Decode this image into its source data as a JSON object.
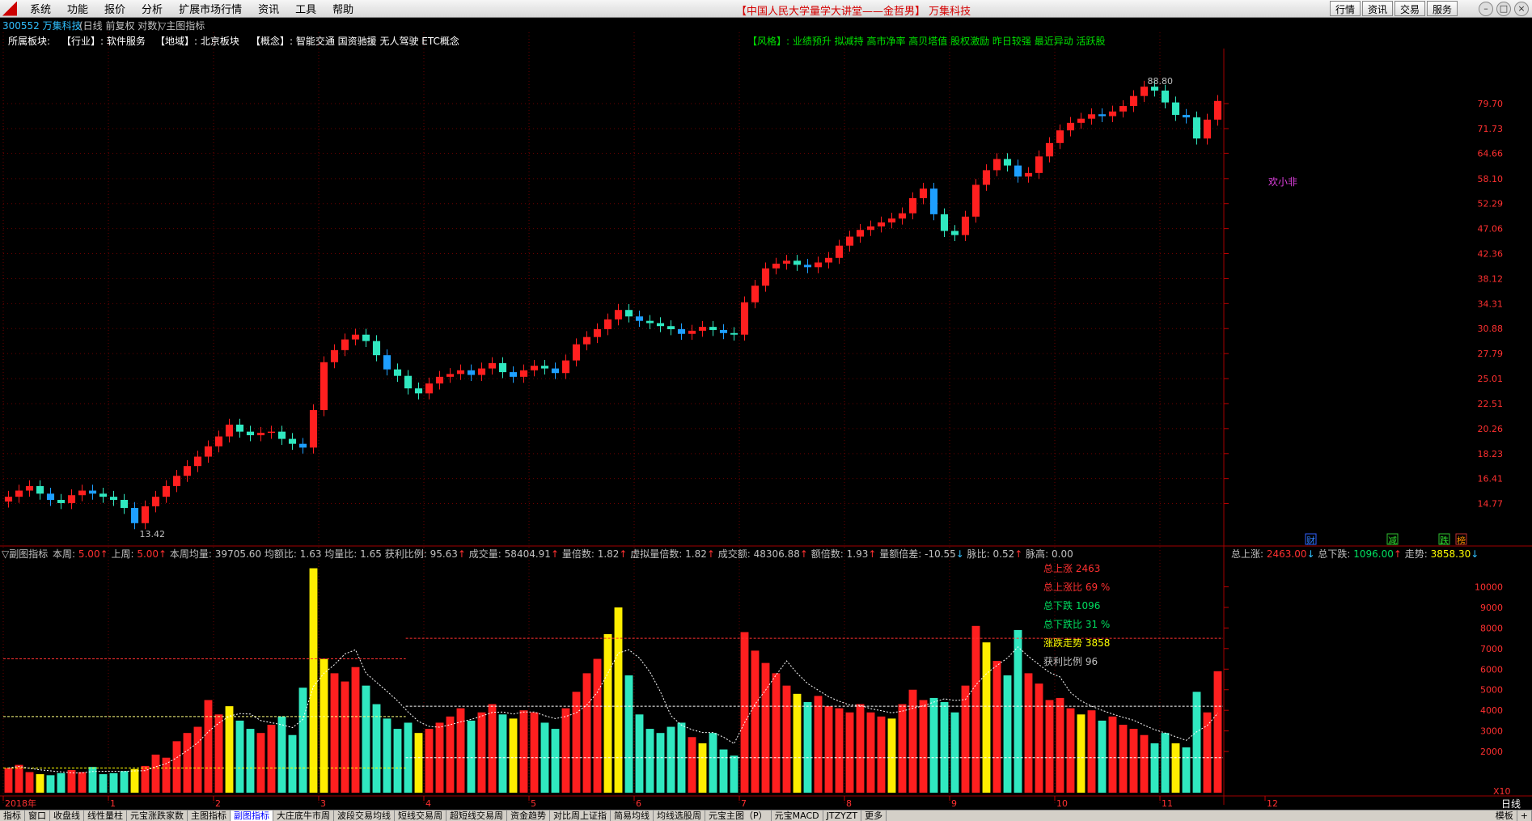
{
  "menubar": {
    "items": [
      "系统",
      "功能",
      "报价",
      "分析",
      "扩展市场行情",
      "资讯",
      "工具",
      "帮助"
    ],
    "center_title": "【中国人民大学量学大讲堂——金哲男】 万集科技",
    "right_buttons": [
      "行情",
      "资讯",
      "交易",
      "服务"
    ]
  },
  "header": {
    "stock_code": "300552 万集科技",
    "mode": "(日线 前复权 对数)",
    "indicator": "▽主图指标"
  },
  "info_line": {
    "label": "所属板块:",
    "industry": "【行业】: 软件服务",
    "region": "【地域】: 北京板块",
    "concept": "【概念】: 智能交通 国资驰援 无人驾驶 ETC概念",
    "style": "【风格】: 业绩预升 拟减持 高市净率 高贝塔值 股权激励 昨日较强 最近异动 活跃股"
  },
  "price_axis": {
    "ticks": [
      "79.70",
      "71.73",
      "64.66",
      "58.10",
      "52.29",
      "47.06",
      "42.36",
      "38.12",
      "34.31",
      "30.88",
      "27.79",
      "25.01",
      "22.51",
      "20.26",
      "18.23",
      "16.41",
      "14.77"
    ],
    "high_label": "88.80",
    "low_label": "13.42",
    "annotation": "欢小非"
  },
  "event_marks": [
    "财",
    "减",
    "跌",
    "榜"
  ],
  "sub_header": {
    "title": "▽副图指标",
    "fields": [
      {
        "label": "本周:",
        "value": "5.00",
        "color": "#ff3030",
        "arrow": "↑",
        "arrow_color": "#ff3030"
      },
      {
        "label": "上周:",
        "value": "5.00",
        "color": "#ff3030",
        "arrow": "↑",
        "arrow_color": "#ff3030"
      },
      {
        "label": "本周均量:",
        "value": "39705.60",
        "color": "#c0c0c0",
        "arrow": "",
        "arrow_color": "#c0c0c0"
      },
      {
        "label": "均额比:",
        "value": "1.63",
        "color": "#c0c0c0",
        "arrow": "",
        "arrow_color": "#c0c0c0"
      },
      {
        "label": "均量比:",
        "value": "1.65",
        "color": "#c0c0c0",
        "arrow": "",
        "arrow_color": "#c0c0c0"
      },
      {
        "label": "获利比例:",
        "value": "95.63",
        "color": "#c0c0c0",
        "arrow": "↑",
        "arrow_color": "#ff3030"
      },
      {
        "label": "成交量:",
        "value": "58404.91",
        "color": "#c0c0c0",
        "arrow": "↑",
        "arrow_color": "#ff3030"
      },
      {
        "label": "量倍数:",
        "value": "1.82",
        "color": "#c0c0c0",
        "arrow": "↑",
        "arrow_color": "#ff3030"
      },
      {
        "label": "虚拟量倍数:",
        "value": "1.82",
        "color": "#c0c0c0",
        "arrow": "↑",
        "arrow_color": "#ff3030"
      },
      {
        "label": "成交额:",
        "value": "48306.88",
        "color": "#c0c0c0",
        "arrow": "↑",
        "arrow_color": "#ff3030"
      },
      {
        "label": "额倍数:",
        "value": "1.93",
        "color": "#c0c0c0",
        "arrow": "↑",
        "arrow_color": "#ff3030"
      },
      {
        "label": "量额倍差:",
        "value": "-10.55",
        "color": "#c0c0c0",
        "arrow": "↓",
        "arrow_color": "#30c0ff"
      },
      {
        "label": "脉比:",
        "value": "0.52",
        "color": "#c0c0c0",
        "arrow": "↑",
        "arrow_color": "#ff3030"
      },
      {
        "label": "脉高:",
        "value": "0.00",
        "color": "#c0c0c0",
        "arrow": "",
        "arrow_color": "#c0c0c0"
      }
    ],
    "right": [
      {
        "label": "总上涨:",
        "value": "2463.00",
        "color": "#ff3030",
        "arrow": "↓",
        "arrow_color": "#30c0ff"
      },
      {
        "label": "总下跌:",
        "value": "1096.00",
        "color": "#00e060",
        "arrow": "↑",
        "arrow_color": "#ff3030"
      },
      {
        "label": "走势:",
        "value": "3858.30",
        "color": "#ffff00",
        "arrow": "↓",
        "arrow_color": "#30c0ff"
      }
    ]
  },
  "stats_box": [
    {
      "text": "总上涨 2463",
      "color": "#ff3030"
    },
    {
      "text": "总上涨比 69 %",
      "color": "#ff3030"
    },
    {
      "text": "总下跌 1096",
      "color": "#00e060"
    },
    {
      "text": "总下跌比 31 %",
      "color": "#00e060"
    },
    {
      "text": "涨跌走势 3858",
      "color": "#ffff00"
    },
    {
      "text": "获利比例 96",
      "color": "#c0c0c0"
    }
  ],
  "volume_axis": {
    "ticks": [
      "10000",
      "9000",
      "8000",
      "7000",
      "6000",
      "5000",
      "4000",
      "3000",
      "2000"
    ],
    "unit": "X10"
  },
  "month_axis": [
    "2018年",
    "1",
    "2",
    "3",
    "4",
    "5",
    "6",
    "7",
    "8",
    "9",
    "10",
    "11",
    "12"
  ],
  "period_label": "日线",
  "tabs": [
    "指标",
    "窗口",
    "收盘线",
    "线性量柱",
    "元宝涨跌家数",
    "主图指标",
    "副图指标",
    "大庄底牛市周",
    "波段交易均线",
    "短线交易周",
    "超短线交易周",
    "资金趋势",
    "对比周上证指",
    "简易均线",
    "均线选股周",
    "元宝主图（P）",
    "元宝MACD",
    "JTZYZT",
    "更多"
  ],
  "active_tab": "副图指标",
  "tab_right": [
    "模板",
    "+"
  ],
  "colors": {
    "up": "#ff1f1f",
    "down": "#30e8c0",
    "down_blue": "#1e9fff",
    "special": "#ffee00",
    "grid": "#6a0000",
    "axis_text": "#ff3030"
  },
  "chart_data": [
    {
      "type": "candlestick",
      "title": "",
      "xlabel": "",
      "ylabel": "",
      "scale": "log",
      "ylim": [
        13.0,
        92.0
      ],
      "x": [
        "2018-01",
        "2018-01",
        "2018-01",
        "2018-01",
        "2018-01",
        "2018-01",
        "2018-01",
        "2018-01",
        "2018-01",
        "2018-01",
        "2018-02",
        "2018-02",
        "2018-02",
        "2018-02",
        "2018-02",
        "2018-02",
        "2018-02",
        "2018-02",
        "2018-02",
        "2018-02",
        "2018-03",
        "2018-03",
        "2018-03",
        "2018-03",
        "2018-03",
        "2018-03",
        "2018-03",
        "2018-03",
        "2018-03",
        "2018-03",
        "2018-04",
        "2018-04",
        "2018-04",
        "2018-04",
        "2018-04",
        "2018-04",
        "2018-04",
        "2018-04",
        "2018-04",
        "2018-04",
        "2018-05",
        "2018-05",
        "2018-05",
        "2018-05",
        "2018-05",
        "2018-05",
        "2018-05",
        "2018-05",
        "2018-05",
        "2018-05",
        "2018-06",
        "2018-06",
        "2018-06",
        "2018-06",
        "2018-06",
        "2018-06",
        "2018-06",
        "2018-06",
        "2018-06",
        "2018-06",
        "2018-07",
        "2018-07",
        "2018-07",
        "2018-07",
        "2018-07",
        "2018-07",
        "2018-07",
        "2018-07",
        "2018-07",
        "2018-07",
        "2018-08",
        "2018-08",
        "2018-08",
        "2018-08",
        "2018-08",
        "2018-08",
        "2018-08",
        "2018-08",
        "2018-08",
        "2018-08",
        "2018-09",
        "2018-09",
        "2018-09",
        "2018-09",
        "2018-09",
        "2018-09",
        "2018-09",
        "2018-09",
        "2018-09",
        "2018-09",
        "2018-10",
        "2018-10",
        "2018-10",
        "2018-10",
        "2018-10",
        "2018-10",
        "2018-10",
        "2018-10",
        "2018-10",
        "2018-10",
        "2018-11",
        "2018-11",
        "2018-11",
        "2018-11",
        "2018-11",
        "2018-11",
        "2018-11",
        "2018-11",
        "2018-11",
        "2018-11",
        "2018-12",
        "2018-12",
        "2018-12",
        "2018-12",
        "2018-12",
        "2018-12"
      ],
      "close": [
        15.2,
        15.6,
        15.9,
        15.4,
        15.0,
        14.8,
        15.3,
        15.6,
        15.4,
        15.2,
        15.0,
        14.5,
        13.6,
        14.6,
        15.2,
        15.9,
        16.6,
        17.3,
        18.0,
        18.8,
        19.6,
        20.6,
        20.0,
        19.7,
        19.9,
        20.0,
        19.4,
        19.0,
        18.7,
        21.9,
        26.8,
        28.2,
        29.5,
        30.1,
        29.3,
        27.6,
        26.0,
        25.3,
        24.0,
        23.5,
        24.5,
        25.2,
        25.5,
        25.9,
        25.4,
        26.1,
        26.7,
        25.7,
        25.2,
        25.9,
        26.4,
        26.1,
        25.6,
        27.0,
        28.9,
        29.8,
        30.8,
        32.1,
        33.4,
        32.5,
        31.9,
        31.6,
        31.2,
        30.8,
        30.2,
        30.6,
        31.1,
        30.7,
        30.3,
        30.1,
        34.5,
        37.0,
        39.8,
        40.6,
        41.1,
        40.4,
        40.0,
        40.8,
        41.6,
        43.8,
        45.5,
        46.8,
        47.5,
        48.3,
        49.1,
        50.2,
        53.5,
        55.7,
        50.0,
        46.6,
        45.8,
        49.5,
        56.6,
        60.2,
        63.1,
        61.4,
        58.6,
        59.5,
        63.8,
        67.5,
        71.2,
        73.5,
        74.8,
        76.2,
        75.6,
        77.1,
        78.9,
        82.3,
        85.6,
        84.2,
        80.1,
        76.0,
        75.2,
        68.8,
        74.5,
        80.6
      ],
      "volume": [
        1200,
        1350,
        1000,
        900,
        850,
        950,
        1100,
        1000,
        1250,
        900,
        950,
        1050,
        1150,
        1300,
        1850,
        1700,
        2500,
        2900,
        3200,
        4500,
        3800,
        4200,
        3500,
        3100,
        2900,
        3300,
        3700,
        2800,
        5100,
        10900,
        6500,
        5800,
        5400,
        6100,
        5200,
        4300,
        3600,
        3100,
        3400,
        2900,
        3100,
        3400,
        3700,
        4100,
        3500,
        3900,
        4300,
        3800,
        3600,
        4000,
        3900,
        3400,
        3100,
        4100,
        4900,
        5800,
        6500,
        7700,
        9000,
        5700,
        3800,
        3100,
        2900,
        3200,
        3400,
        2700,
        2400,
        2900,
        2100,
        1800,
        7800,
        6900,
        6300,
        5800,
        5200,
        4800,
        4400,
        4700,
        4200,
        4100,
        3900,
        4300,
        3900,
        3700,
        3600,
        4300,
        5000,
        4500,
        4600,
        4400,
        3900,
        5200,
        8100,
        7300,
        6400,
        5700,
        7900,
        5800,
        5300,
        4500,
        4600,
        4100,
        3800,
        4000,
        3500,
        3700,
        3300,
        3100,
        2800,
        2400,
        2900,
        2400,
        2200,
        4900,
        3900,
        5900
      ]
    }
  ]
}
